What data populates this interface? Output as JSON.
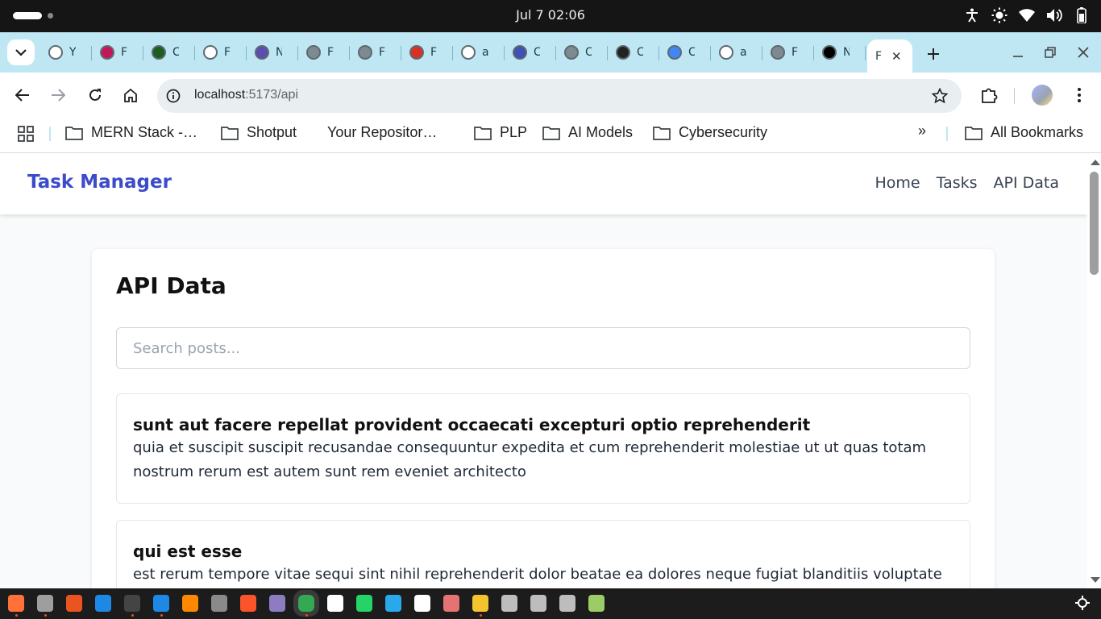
{
  "os": {
    "clock": "Jul 7  02:06"
  },
  "browser": {
    "tabs": [
      {
        "favicon": "github-icon",
        "title": "Y",
        "color": "#ffffff"
      },
      {
        "favicon": "slides-icon",
        "title": "F",
        "color": "#c2185b"
      },
      {
        "favicon": "github-icon",
        "title": "C",
        "color": "#1b5e20"
      },
      {
        "favicon": "github-icon",
        "title": "F",
        "color": "#ffffff"
      },
      {
        "favicon": "bird-icon",
        "title": "N",
        "color": "#5c4db1"
      },
      {
        "favicon": "globe-icon",
        "title": "F",
        "color": "#7e8a92"
      },
      {
        "favicon": "globe-icon",
        "title": "F",
        "color": "#7e8a92"
      },
      {
        "favicon": "gmail-icon",
        "title": "F",
        "color": "#d93025"
      },
      {
        "favicon": "github-icon",
        "title": "a",
        "color": "#ffffff"
      },
      {
        "favicon": "person-icon",
        "title": "C",
        "color": "#3f51b5"
      },
      {
        "favicon": "globe-icon",
        "title": "C",
        "color": "#7e8a92"
      },
      {
        "favicon": "openai-icon",
        "title": "C",
        "color": "#222222"
      },
      {
        "favicon": "gemini-icon",
        "title": "C",
        "color": "#4285f4"
      },
      {
        "favicon": "google-icon",
        "title": "a",
        "color": "#ffffff"
      },
      {
        "favicon": "globe-icon",
        "title": "F",
        "color": "#7e8a92"
      },
      {
        "favicon": "vercel-icon",
        "title": "N",
        "color": "#000000"
      }
    ],
    "active_tab": {
      "title": "F",
      "close": "✕"
    },
    "url_host": "localhost",
    "url_path": ":5173/api",
    "bookmarks": [
      {
        "label": "MERN Stack -…",
        "icon": "folder-icon"
      },
      {
        "label": "Shotput",
        "icon": "folder-icon"
      },
      {
        "label": "Your Repositor…",
        "icon": "github-icon"
      },
      {
        "label": "PLP",
        "icon": "folder-icon"
      },
      {
        "label": "AI Models",
        "icon": "folder-icon"
      },
      {
        "label": "Cybersecurity",
        "icon": "folder-icon"
      }
    ],
    "more_bookmarks": "»",
    "all_bookmarks": "All Bookmarks"
  },
  "app": {
    "brand": "Task Manager",
    "nav": [
      "Home",
      "Tasks",
      "API Data"
    ],
    "page_title": "API Data",
    "search_placeholder": "Search posts...",
    "posts": [
      {
        "title": "sunt aut facere repellat provident occaecati excepturi optio reprehenderit",
        "body": "quia et suscipit suscipit recusandae consequuntur expedita et cum reprehenderit molestiae ut ut quas totam nostrum rerum est autem sunt rem eveniet architecto"
      },
      {
        "title": "qui est esse",
        "body": "est rerum tempore vitae sequi sint nihil reprehenderit dolor beatae ea dolores neque fugiat blanditiis voluptate"
      }
    ],
    "colors": {
      "brand": "#3b4cca",
      "background": "#f9fafb"
    }
  },
  "dock": [
    {
      "icon": "firefox-icon",
      "color": "#ff7139",
      "running": true
    },
    {
      "icon": "files-icon",
      "color": "#9e9e9e",
      "running": true
    },
    {
      "icon": "software-icon",
      "color": "#e95420",
      "running": false
    },
    {
      "icon": "help-icon",
      "color": "#1e88e5",
      "running": false
    },
    {
      "icon": "terminal-icon",
      "color": "#444444",
      "running": true
    },
    {
      "icon": "vscode-icon",
      "color": "#1e88e5",
      "running": true
    },
    {
      "icon": "vlc-icon",
      "color": "#ff8800",
      "running": false
    },
    {
      "icon": "settings-icon",
      "color": "#8a8a8a",
      "running": false
    },
    {
      "icon": "brave-icon",
      "color": "#fb542b",
      "running": false
    },
    {
      "icon": "app-icon",
      "color": "#8e7cc3",
      "running": false
    },
    {
      "icon": "chrome-icon",
      "color": "#34a853",
      "running": true,
      "active": true
    },
    {
      "icon": "mongodb-icon",
      "color": "#ffffff",
      "running": false
    },
    {
      "icon": "whatsapp-icon",
      "color": "#25d366",
      "running": false
    },
    {
      "icon": "telegram-icon",
      "color": "#29a9eb",
      "running": false
    },
    {
      "icon": "github-desktop-icon",
      "color": "#ffffff",
      "running": false
    },
    {
      "icon": "color-picker-icon",
      "color": "#e57373",
      "running": false
    },
    {
      "icon": "text-editor-icon",
      "color": "#f4c430",
      "running": true
    },
    {
      "icon": "drive-icon",
      "color": "#bdbdbd",
      "running": false
    },
    {
      "icon": "drive-icon",
      "color": "#bdbdbd",
      "running": false
    },
    {
      "icon": "drive-icon",
      "color": "#bdbdbd",
      "running": false
    },
    {
      "icon": "trash-icon",
      "color": "#9ccc65",
      "running": false
    }
  ]
}
